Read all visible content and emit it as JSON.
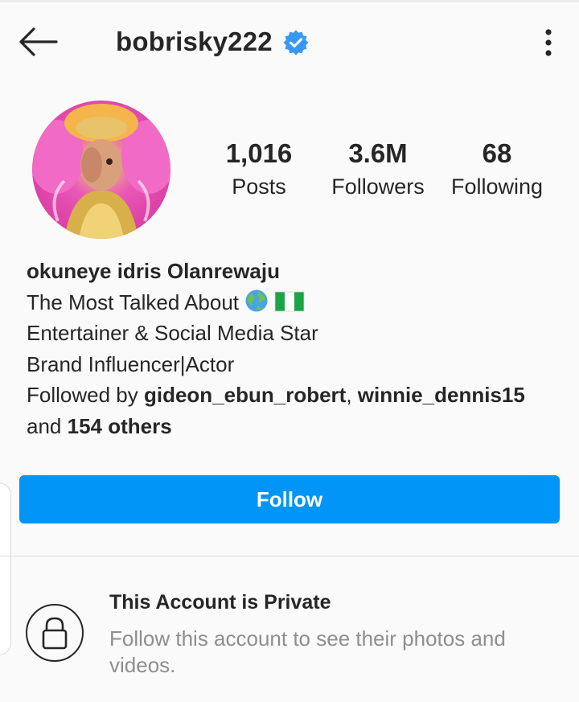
{
  "header": {
    "username": "bobrisky222",
    "back_icon": "arrow-left-icon",
    "verified_icon": "verified-badge-icon",
    "more_icon": "more-vertical-icon"
  },
  "stats": {
    "posts": {
      "value": "1,016",
      "label": "Posts"
    },
    "followers": {
      "value": "3.6M",
      "label": "Followers"
    },
    "following": {
      "value": "68",
      "label": "Following"
    }
  },
  "bio": {
    "full_name": "okuneye idris Olanrewaju",
    "line1": "The Most Talked About ",
    "line1_emojis": [
      "globe-emoji",
      "nigeria-flag-emoji"
    ],
    "line2": "Entertainer & Social Media Star",
    "line3": "Brand Influencer|Actor",
    "followed_by_prefix": "Followed by ",
    "followed_by_user1": "gideon_ebun_robert",
    "separator": ", ",
    "followed_by_user2": "winnie_dennis15",
    "and_text": "and ",
    "others": "154 others"
  },
  "follow_button": {
    "label": "Follow"
  },
  "private": {
    "title": "This Account is Private",
    "description": "Follow this account to see their photos and videos.",
    "icon": "lock-icon"
  },
  "colors": {
    "accent": "#0095f6",
    "verified": "#3897f0",
    "muted": "#8e8e8e",
    "text": "#262626"
  }
}
